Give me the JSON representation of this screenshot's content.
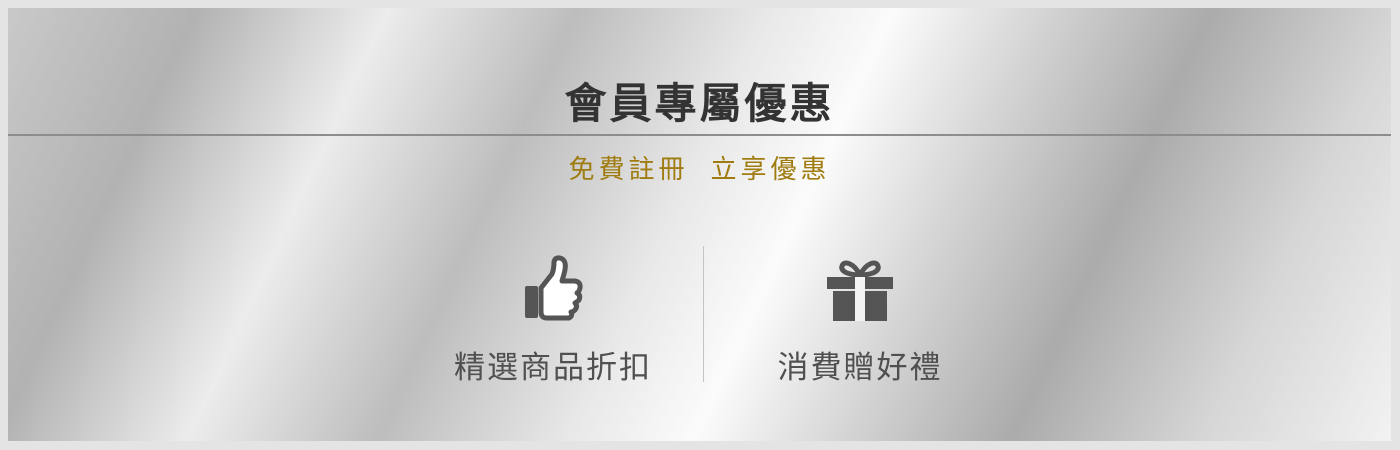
{
  "banner": {
    "title": "會員專屬優惠",
    "subtitle_left": "免費註冊",
    "subtitle_right": "立享優惠",
    "accent_color": "#a07c10"
  },
  "features": [
    {
      "label": "精選商品折扣",
      "icon": "thumbs-up-icon"
    },
    {
      "label": "消費贈好禮",
      "icon": "gift-icon"
    }
  ]
}
